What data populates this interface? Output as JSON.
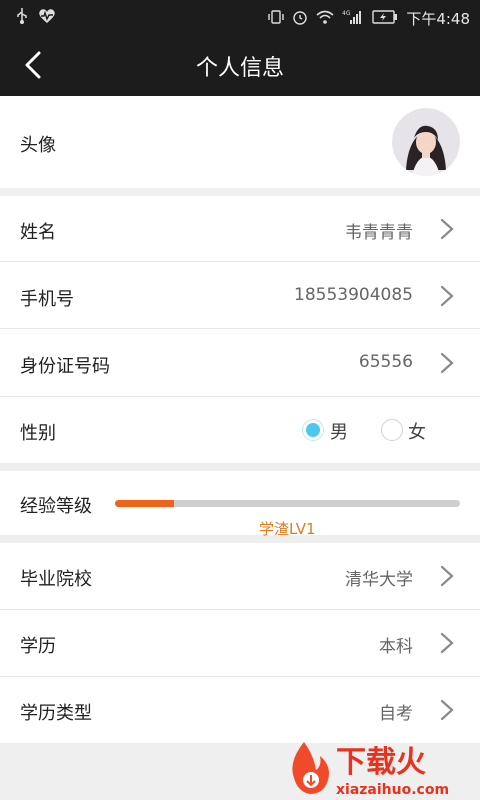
{
  "status": {
    "time": "下午4:48",
    "net": "4G"
  },
  "header": {
    "title": "个人信息"
  },
  "avatar_row": {
    "label": "头像"
  },
  "fields": [
    {
      "label": "姓名",
      "value": "韦青青青"
    },
    {
      "label": "手机号",
      "value": "18553904085"
    },
    {
      "label": "身份证号码",
      "value": "65556"
    }
  ],
  "gender": {
    "label": "性别",
    "options": [
      "男",
      "女"
    ],
    "selected": "男"
  },
  "level": {
    "label": "经验等级",
    "name": "学渣LV1",
    "progress": 0.17
  },
  "education": [
    {
      "label": "毕业院校",
      "value": "清华大学"
    },
    {
      "label": "学历",
      "value": "本科"
    },
    {
      "label": "学历类型",
      "value": "自考"
    }
  ],
  "watermark": {
    "brand": "下载火",
    "url": "xiazaihuo.com"
  },
  "colors": {
    "accent": "#ef6218",
    "radio_selected": "#4cc8ee",
    "level_text": "#e07b1f"
  }
}
